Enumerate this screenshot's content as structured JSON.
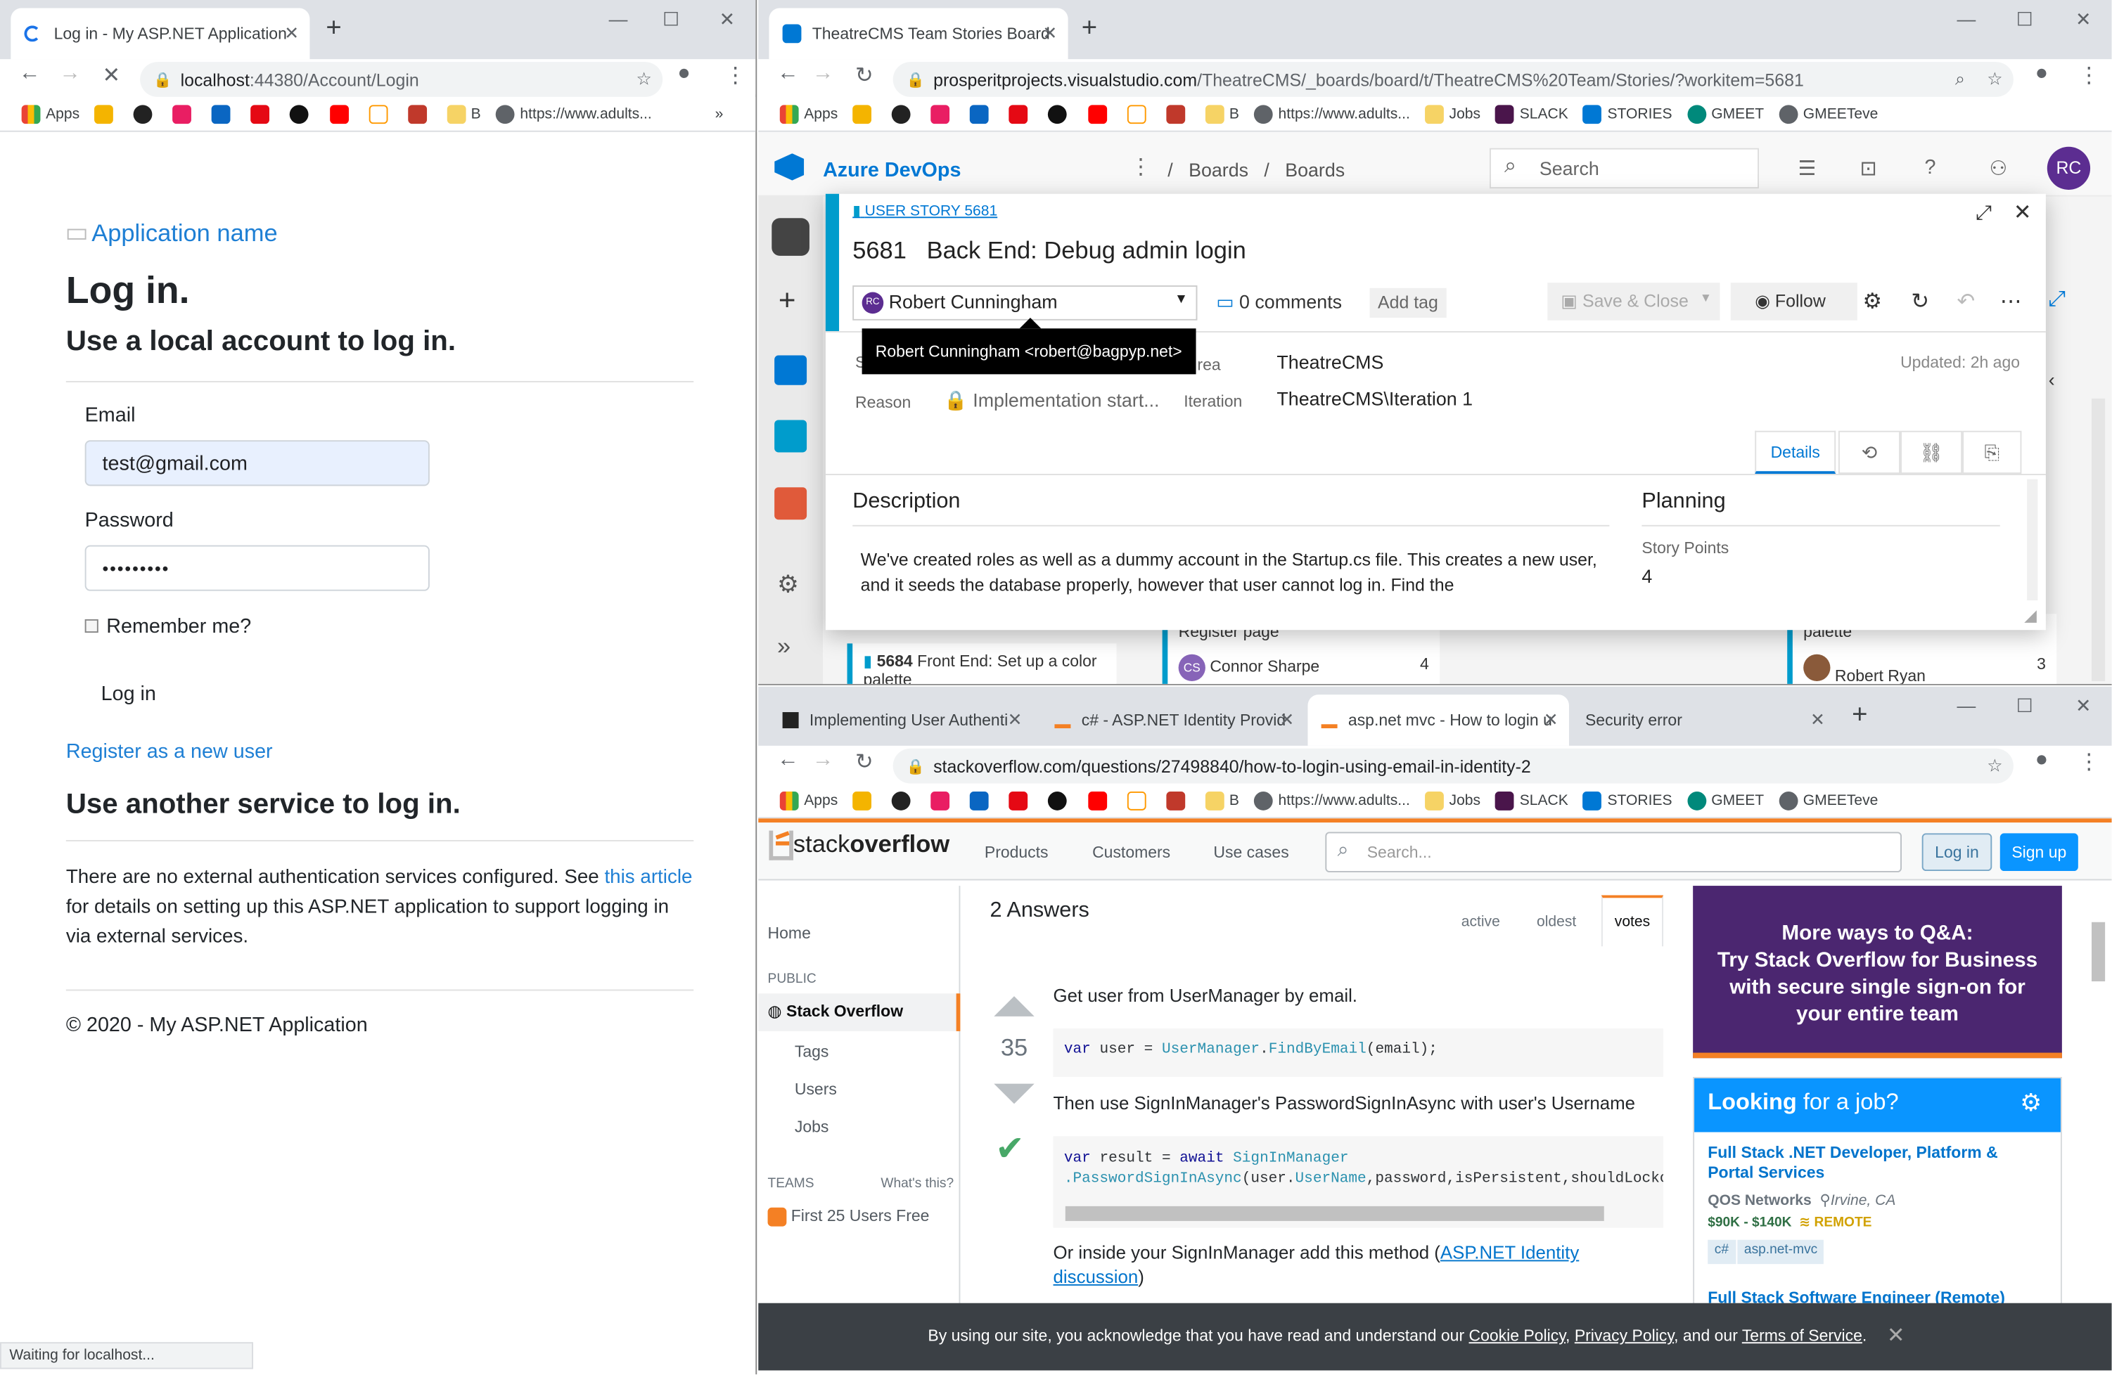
{
  "left_window": {
    "tab_title": "Log in - My ASP.NET Application",
    "url_host": "localhost",
    "url_rest": ":44380/Account/Login",
    "bookmarks": [
      "Apps",
      "B",
      "https://www.adults..."
    ],
    "page": {
      "brand": "Application name",
      "title": "Log in.",
      "subtitle": "Use a local account to log in.",
      "email_label": "Email",
      "email_value": "test@gmail.com",
      "password_label": "Password",
      "password_value": "•••••••••",
      "remember_label": "Remember me?",
      "login_button": "Log in",
      "register_link": "Register as a new user",
      "other_heading": "Use another service to log in.",
      "other_text_pre": "There are no external authentication services configured. See ",
      "other_link": "this article",
      "other_text_post": " for details on setting up this ASP.NET application to support logging in via external services.",
      "footer": "© 2020 - My ASP.NET Application"
    },
    "status_bar": "Waiting for localhost..."
  },
  "ado_window": {
    "tab_title": "TheatreCMS Team Stories Board",
    "url_host": "prosperitprojects.visualstudio.com",
    "url_rest": "/TheatreCMS/_boards/board/t/TheatreCMS%20Team/Stories/?workitem=5681",
    "bookmarks": [
      "Apps",
      "B",
      "https://www.adults...",
      "Jobs",
      "SLACK",
      "STORIES",
      "GMEET",
      "GMEETeve"
    ],
    "product": "Azure DevOps",
    "breadcrumb": [
      "Boards",
      "Boards"
    ],
    "search_placeholder": "Search",
    "avatar": "RC",
    "work_item": {
      "type_label": "USER STORY 5681",
      "id": "5681",
      "title": "Back End: Debug admin login",
      "assignee": "Robert Cunningham",
      "assignee_initials": "RC",
      "comments": "0 comments",
      "add_tag": "Add tag",
      "save_close": "Save & Close",
      "follow": "Follow",
      "tooltip": "Robert Cunningham <robert@bagpyp.net>",
      "state_label": "S",
      "reason_label": "Reason",
      "reason_value": "Implementation start...",
      "area_label": "rea",
      "area_value": "TheatreCMS",
      "iteration_label": "Iteration",
      "iteration_value": "TheatreCMS\\Iteration 1",
      "updated": "Updated: 2h ago",
      "details_tab": "Details",
      "description_heading": "Description",
      "description_text": "We've created roles as well as a dummy account in the Startup.cs file. This creates a new user, and it seeds the database properly, however that user cannot log in. Find the",
      "planning_heading": "Planning",
      "story_points_label": "Story Points",
      "story_points_value": "4"
    },
    "board_cards": [
      {
        "id": "5684",
        "title": "Front End: Set up a color palette"
      },
      {
        "title": "Register page",
        "assignee": "Connor Sharpe",
        "initials": "CS",
        "points": "4"
      },
      {
        "title": "palette",
        "assignee": "Robert Ryan",
        "points": "3"
      }
    ]
  },
  "so_window": {
    "tabs": [
      "Implementing User Authenti",
      "c# - ASP.NET Identity Provid",
      "asp.net mvc - How to login u",
      "Security error"
    ],
    "url": "stackoverflow.com/questions/27498840/how-to-login-using-email-in-identity-2",
    "bookmarks": [
      "Apps",
      "B",
      "https://www.adults...",
      "Jobs",
      "SLACK",
      "STORIES",
      "GMEET",
      "GMEETeve"
    ],
    "logo_a": "stack",
    "logo_b": "overflow",
    "nav": [
      "Products",
      "Customers",
      "Use cases"
    ],
    "search_placeholder": "Search...",
    "login": "Log in",
    "signup": "Sign up",
    "sidebar": {
      "home": "Home",
      "public": "PUBLIC",
      "stack_overflow": "Stack Overflow",
      "tags": "Tags",
      "users": "Users",
      "jobs": "Jobs",
      "teams": "TEAMS",
      "whats_this": "What's this?",
      "first25": "First 25 Users Free"
    },
    "answers_heading": "2 Answers",
    "sort_tabs": [
      "active",
      "oldest",
      "votes"
    ],
    "vote_count": "35",
    "answer_p1": "Get user from UserManager by email.",
    "code1": [
      "var",
      "user",
      "=",
      "UserManager",
      ".",
      "FindByEmail",
      "(email);"
    ],
    "answer_p2": "Then use SignInManager's PasswordSignInAsync with user's Username",
    "code2_line1": [
      "var",
      "result",
      "=",
      "await",
      "SignInManager"
    ],
    "code2_line2": [
      ".PasswordSignInAsync",
      "(user.",
      "UserName",
      ",password,isPersistent,shouldLocko"
    ],
    "answer_p3_pre": "Or inside your SignInManager add this method (",
    "answer_p3_link": "ASP.NET Identity discussion",
    "answer_p3_post": ")",
    "ad_lines": [
      "More ways to Q&A:",
      "Try Stack Overflow for Business",
      "with secure single sign-on for",
      "your entire team"
    ],
    "jobs_heading_a": "Looking",
    "jobs_heading_b": " for a job?",
    "job1_title": "Full Stack .NET Developer, Platform & Portal Services",
    "job1_company": "QOS Networks",
    "job1_location": "Irvine, CA",
    "job1_salary": "$90K - $140K",
    "job1_remote": "REMOTE",
    "job1_tags": [
      "c#",
      "asp.net-mvc"
    ],
    "job2_title": "Full Stack Software Engineer (Remote)",
    "cookie_pre": "By using our site, you acknowledge that you have read and understand our ",
    "cookie_l1": "Cookie Policy",
    "cookie_mid1": ", ",
    "cookie_l2": "Privacy Policy",
    "cookie_mid2": ", and our ",
    "cookie_l3": "Terms of Service",
    "cookie_post": "."
  }
}
